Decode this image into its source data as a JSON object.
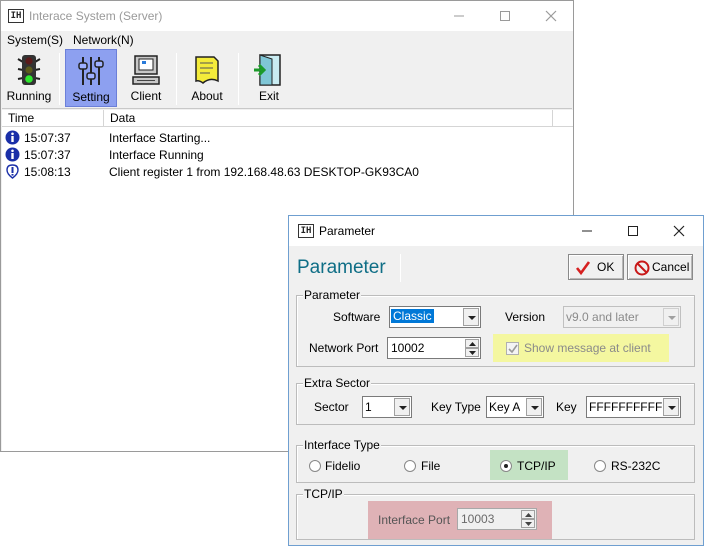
{
  "main_window": {
    "app_icon_text": "IH",
    "title": "Interace System (Server)",
    "menu": [
      "System(S)",
      "Network(N)"
    ],
    "toolbar": [
      {
        "label": "Running",
        "icon": "traffic-light-icon"
      },
      {
        "label": "Setting",
        "icon": "sliders-icon",
        "active": true
      },
      {
        "label": "Client",
        "icon": "computer-icon"
      },
      {
        "label": "About",
        "icon": "note-icon"
      },
      {
        "label": "Exit",
        "icon": "exit-door-icon"
      }
    ],
    "log": {
      "columns": [
        "Time",
        "Data"
      ],
      "rows": [
        {
          "time": "15:07:37",
          "data": "Interface Starting...",
          "icon": "info-icon"
        },
        {
          "time": "15:07:37",
          "data": "Interface Running",
          "icon": "info-icon"
        },
        {
          "time": "15:08:13",
          "data": "Client register 1 from 192.168.48.63 DESKTOP-GK93CA0",
          "icon": "download-info-icon"
        }
      ]
    }
  },
  "dialog": {
    "app_icon_text": "IH",
    "title": "Parameter",
    "heading": "Parameter",
    "ok_label": "OK",
    "cancel_label": "Cancel",
    "parameter_group": {
      "title": "Parameter",
      "software_label": "Software",
      "software_value": "Classic",
      "version_label": "Version",
      "version_value": "v9.0 and later",
      "network_port_label": "Network Port",
      "network_port_value": "10002",
      "show_message_label": "Show message at client",
      "show_message_checked": true
    },
    "extra_sector_group": {
      "title": "Extra Sector",
      "sector_label": "Sector",
      "sector_value": "1",
      "key_type_label": "Key Type",
      "key_type_value": "Key A",
      "key_label": "Key",
      "key_value": "FFFFFFFFFFFF"
    },
    "interface_type_group": {
      "title": "Interface Type",
      "options": [
        "Fidelio",
        "File",
        "TCP/IP",
        "RS-232C"
      ],
      "selected": "TCP/IP"
    },
    "tcpip_group": {
      "title": "TCP/IP",
      "interface_port_label": "Interface Port",
      "interface_port_value": "10003"
    }
  },
  "colors": {
    "setting_button_highlight": "#8da0f0",
    "show_message_highlight": "#f4f7a0",
    "tcpip_highlight": "#c4e2c4",
    "interface_port_highlight": "#dfb2b6",
    "heading_color": "#0f6e86"
  }
}
